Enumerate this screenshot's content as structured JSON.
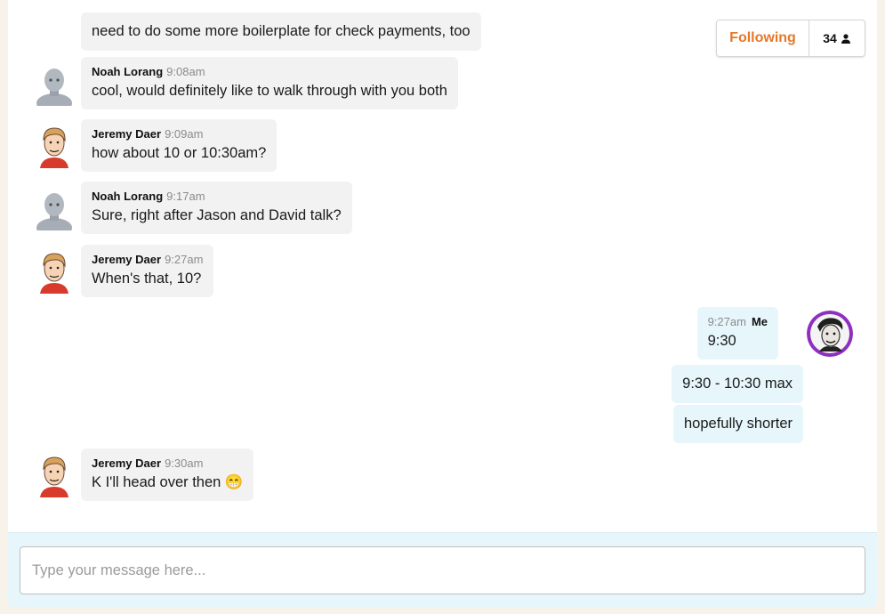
{
  "header": {
    "follow_label": "Following",
    "follower_count": "34",
    "follow_color": "#e5782b"
  },
  "messages": [
    {
      "author": "",
      "time": "",
      "text": "need to do some more boilerplate for check payments, too"
    },
    {
      "author": "Noah Lorang",
      "time": "9:08am",
      "text": "cool, would definitely like to walk through with you both",
      "avatar": "person-placeholder-icon"
    },
    {
      "author": "Jeremy Daer",
      "time": "9:09am",
      "text": "how about 10 or 10:30am?",
      "avatar": "cartoon-avatar"
    },
    {
      "author": "Noah Lorang",
      "time": "9:17am",
      "text": "Sure, right after Jason and David talk?",
      "avatar": "person-placeholder-icon"
    },
    {
      "author": "Jeremy Daer",
      "time": "9:27am",
      "text": "When's that, 10?",
      "avatar": "cartoon-avatar"
    },
    {
      "author": "Me",
      "time": "9:27am",
      "text": "9:30",
      "mine": true
    },
    {
      "author": "",
      "time": "",
      "text": "9:30 - 10:30 max",
      "mine": true
    },
    {
      "author": "",
      "time": "",
      "text": "hopefully shorter",
      "mine": true
    },
    {
      "author": "Jeremy Daer",
      "time": "9:30am",
      "text": "K I'll head over then",
      "emoji": "😁",
      "avatar": "cartoon-avatar"
    }
  ],
  "composer": {
    "placeholder": "Type your message here..."
  },
  "colors": {
    "page_bg": "#f7f2ea",
    "bubble_other": "#f2f2f2",
    "bubble_mine": "#e6f6fb",
    "me_avatar_ring": "#8e2fc0"
  }
}
